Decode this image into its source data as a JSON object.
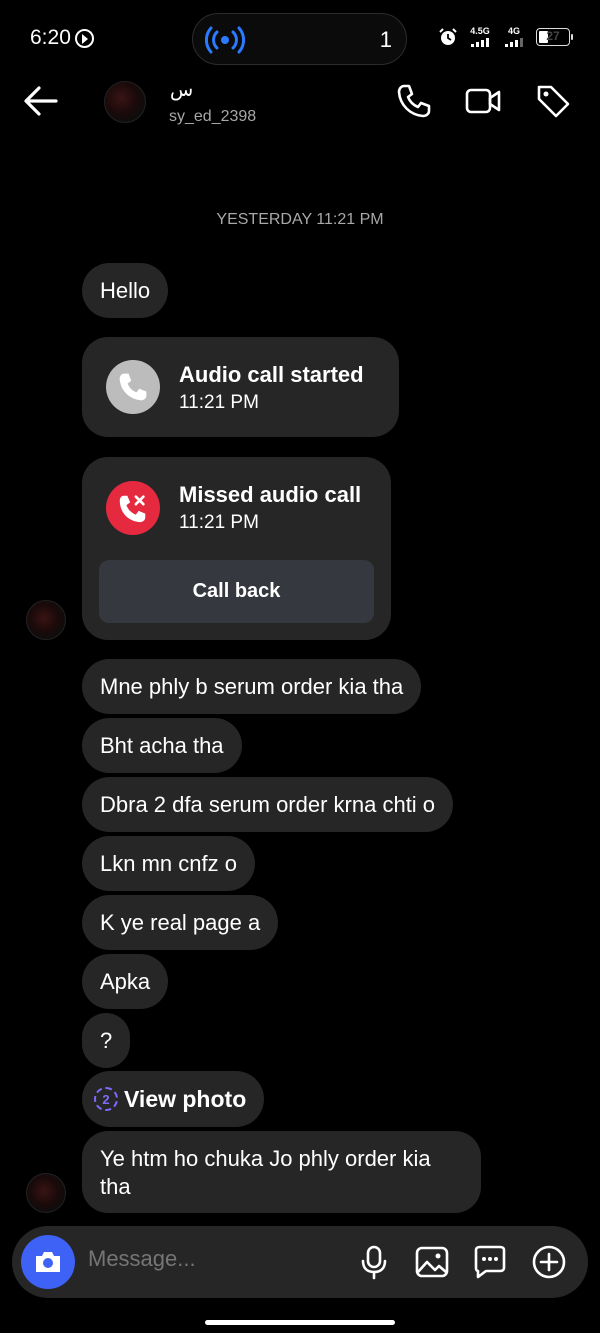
{
  "status_bar": {
    "time": "6:20",
    "island_count": "1",
    "signal_1": "4.5G",
    "signal_2": "4G",
    "battery": "27"
  },
  "header": {
    "name": "س",
    "username": "sy_ed_2398"
  },
  "chat": {
    "day_label": "YESTERDAY 11:21 PM",
    "first_message": "Hello",
    "call_started": {
      "title": "Audio call started",
      "time": "11:21 PM"
    },
    "missed_call": {
      "title": "Missed audio call",
      "time": "11:21 PM",
      "action": "Call back"
    },
    "messages": [
      "Mne phly b serum order kia tha",
      "Bht acha tha",
      "Dbra 2 dfa serum order krna chti o",
      "Lkn mn cnfz o",
      "K ye real page a",
      "Apka",
      "?"
    ],
    "view_photo": {
      "count": "2",
      "label": "View photo"
    },
    "last_message": "Ye htm ho chuka Jo phly order kia tha"
  },
  "composer": {
    "placeholder": "Message..."
  },
  "colors": {
    "background": "#000000",
    "bubble": "#262626",
    "camera_button": "#3d62f5",
    "missed_call_red": "#e5293f",
    "view_photo_accent": "#7d6cff"
  }
}
